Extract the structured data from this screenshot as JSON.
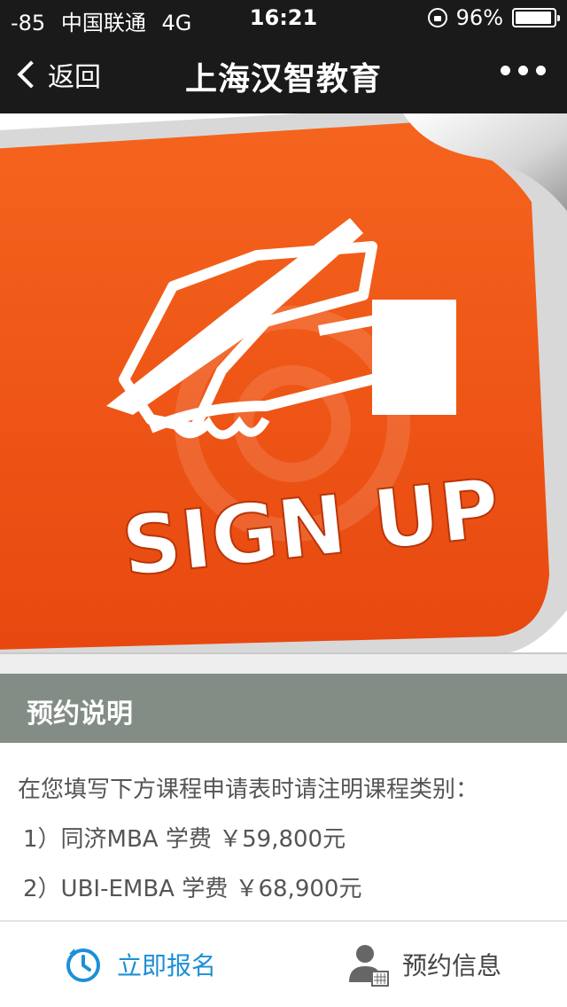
{
  "status_bar": {
    "signal": "-85",
    "carrier": "中国联通",
    "network": "4G",
    "time": "16:21",
    "battery_percent": "96%",
    "battery_level": 0.96
  },
  "nav": {
    "back_label": "返回",
    "title": "上海汉智教育"
  },
  "banner": {
    "text": "SIGN UP"
  },
  "section": {
    "title": "预约说明"
  },
  "content": {
    "intro": "在您填写下方课程申请表时请注明课程类别：",
    "items": [
      "1）同济MBA 学费 ￥59,800元",
      "2）UBI-EMBA 学费 ￥68,900元"
    ]
  },
  "bottom_bar": {
    "signup_label": "立即报名",
    "info_label": "预约信息"
  },
  "colors": {
    "nav_background": "#1a1a1a",
    "banner_orange": "#f0561c",
    "section_header": "#848c86",
    "accent_blue": "#1d8fd8"
  }
}
